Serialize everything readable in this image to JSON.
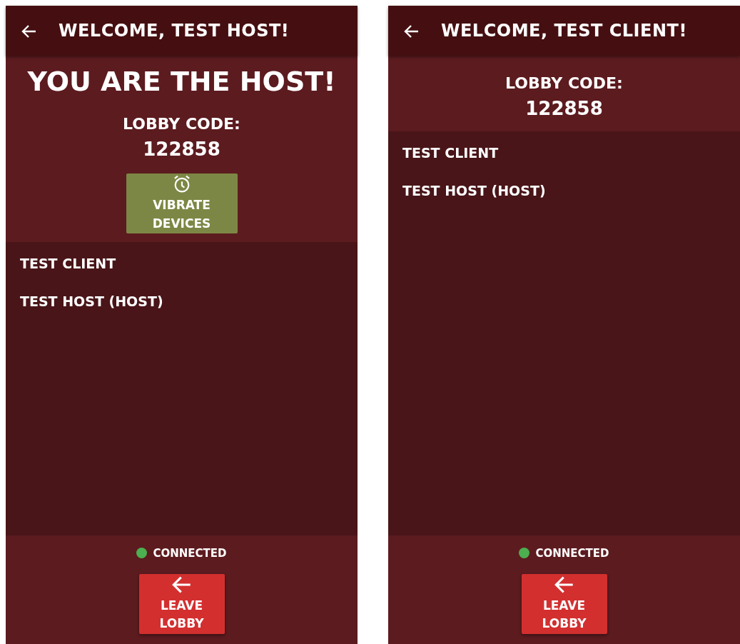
{
  "screens": [
    {
      "header": {
        "title": "WELCOME, TEST HOST!"
      },
      "role_heading": "YOU ARE THE HOST!",
      "lobby_label": "LOBBY CODE:",
      "lobby_code": "122858",
      "vibrate_button": {
        "label": "VIBRATE DEVICES"
      },
      "players": [
        "TEST CLIENT",
        "TEST HOST (HOST)"
      ],
      "status": {
        "label": "CONNECTED",
        "color": "#4caf50"
      },
      "leave_button": {
        "label": "LEAVE LOBBY"
      }
    },
    {
      "header": {
        "title": "WELCOME, TEST CLIENT!"
      },
      "lobby_label": "LOBBY CODE:",
      "lobby_code": "122858",
      "players": [
        "TEST CLIENT",
        "TEST HOST (HOST)"
      ],
      "status": {
        "label": "CONNECTED",
        "color": "#4caf50"
      },
      "leave_button": {
        "label": "LEAVE LOBBY"
      }
    }
  ]
}
